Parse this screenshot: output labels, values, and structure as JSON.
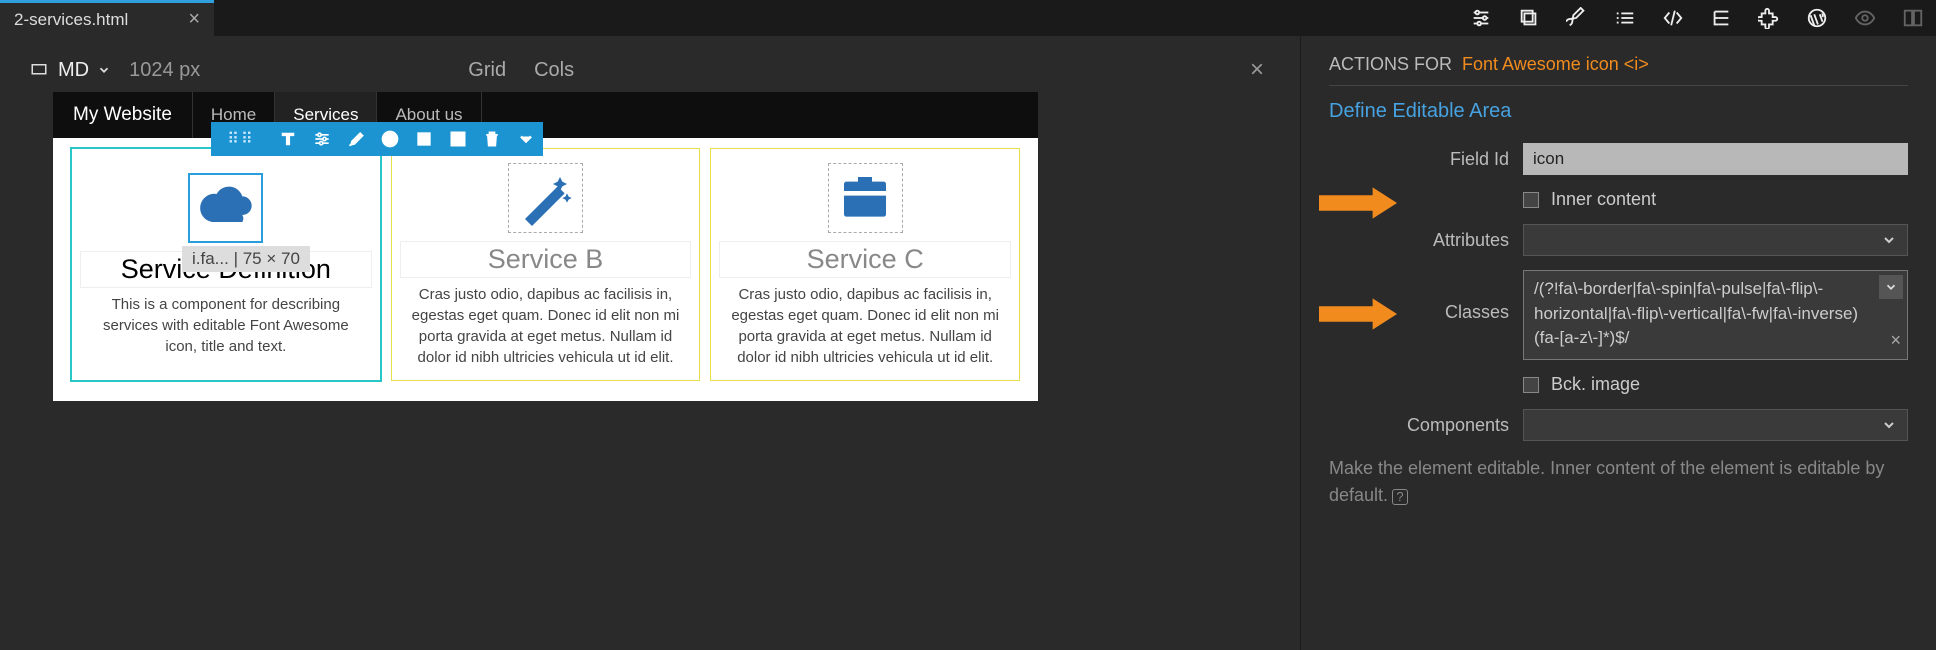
{
  "tab": {
    "filename": "2-services.html"
  },
  "viewport": {
    "breakpoint": "MD",
    "size": "1024 px",
    "controls": [
      "Grid",
      "Cols"
    ]
  },
  "navbar": {
    "brand": "My Website",
    "links": [
      {
        "label": "Home",
        "active": false
      },
      {
        "label": "Services",
        "active": true
      },
      {
        "label": "About us",
        "active": false
      }
    ]
  },
  "selected_badge": "i.fa...  |  75 × 70",
  "columns": [
    {
      "icon": "cloud",
      "title": "Service Definition",
      "text": "This is a component for describing services with editable Font Awesome icon, title and text.",
      "selected": true
    },
    {
      "icon": "magic-wand",
      "title": "Service B",
      "text": "Cras justo odio, dapibus ac facilisis in, egestas eget quam. Donec id elit non mi porta gravida at eget metus. Nullam id dolor id nibh ultricies vehicula ut id elit.",
      "selected": false
    },
    {
      "icon": "briefcase",
      "title": "Service C",
      "text": "Cras justo odio, dapibus ac facilisis in, egestas eget quam. Donec id elit non mi porta gravida at eget metus. Nullam id dolor id nibh ultricies vehicula ut id elit.",
      "selected": false
    }
  ],
  "panel": {
    "actions_for": "ACTIONS FOR",
    "target": "Font Awesome icon <i>",
    "section": "Define Editable Area",
    "field_id_label": "Field Id",
    "field_id_value": "icon",
    "inner_content_label": "Inner content",
    "attributes_label": "Attributes",
    "classes_label": "Classes",
    "classes_value": "/(?!fa\\-border|fa\\-spin|fa\\-pulse|fa\\-flip\\-horizontal|fa\\-flip\\-vertical|fa\\-fw|fa\\-inverse)(fa-[a-z\\-]*)$/",
    "bck_image_label": "Bck. image",
    "components_label": "Components",
    "hint": "Make the element editable. Inner content of the element is editable by default."
  }
}
